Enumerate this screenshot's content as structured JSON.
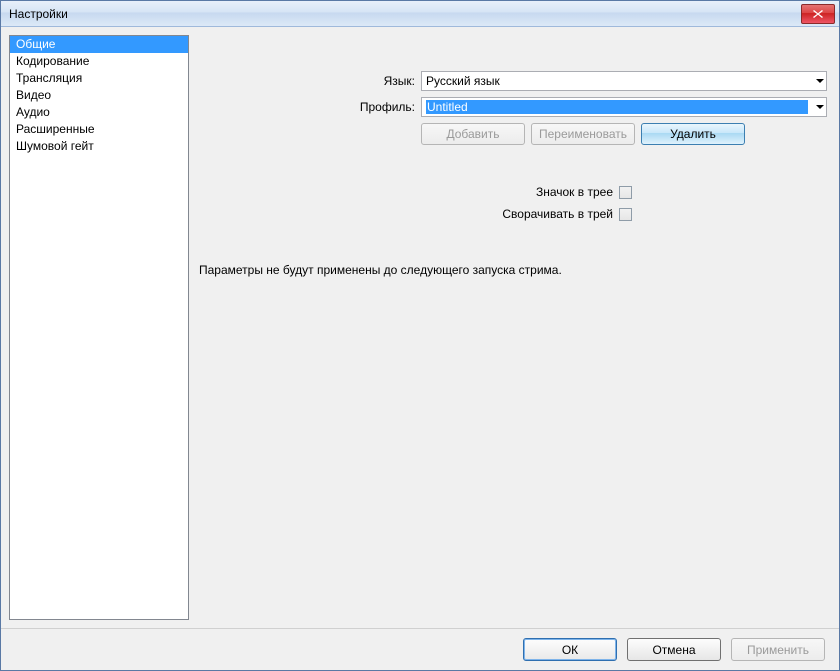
{
  "title": "Настройки",
  "sidebar": {
    "items": [
      {
        "label": "Общие",
        "selected": true
      },
      {
        "label": "Кодирование",
        "selected": false
      },
      {
        "label": "Трансляция",
        "selected": false
      },
      {
        "label": "Видео",
        "selected": false
      },
      {
        "label": "Аудио",
        "selected": false
      },
      {
        "label": "Расширенные",
        "selected": false
      },
      {
        "label": "Шумовой гейт",
        "selected": false
      }
    ]
  },
  "form": {
    "language_label": "Язык:",
    "language_value": "Русский язык",
    "profile_label": "Профиль:",
    "profile_value": "Untitled",
    "add_label": "Добавить",
    "rename_label": "Переименовать",
    "delete_label": "Удалить",
    "tray_icon_label": "Значок в трее",
    "minimize_tray_label": "Сворачивать в трей"
  },
  "note": "Параметры не будут применены до следующего запуска стрима.",
  "footer": {
    "ok": "ОК",
    "cancel": "Отмена",
    "apply": "Применить"
  }
}
